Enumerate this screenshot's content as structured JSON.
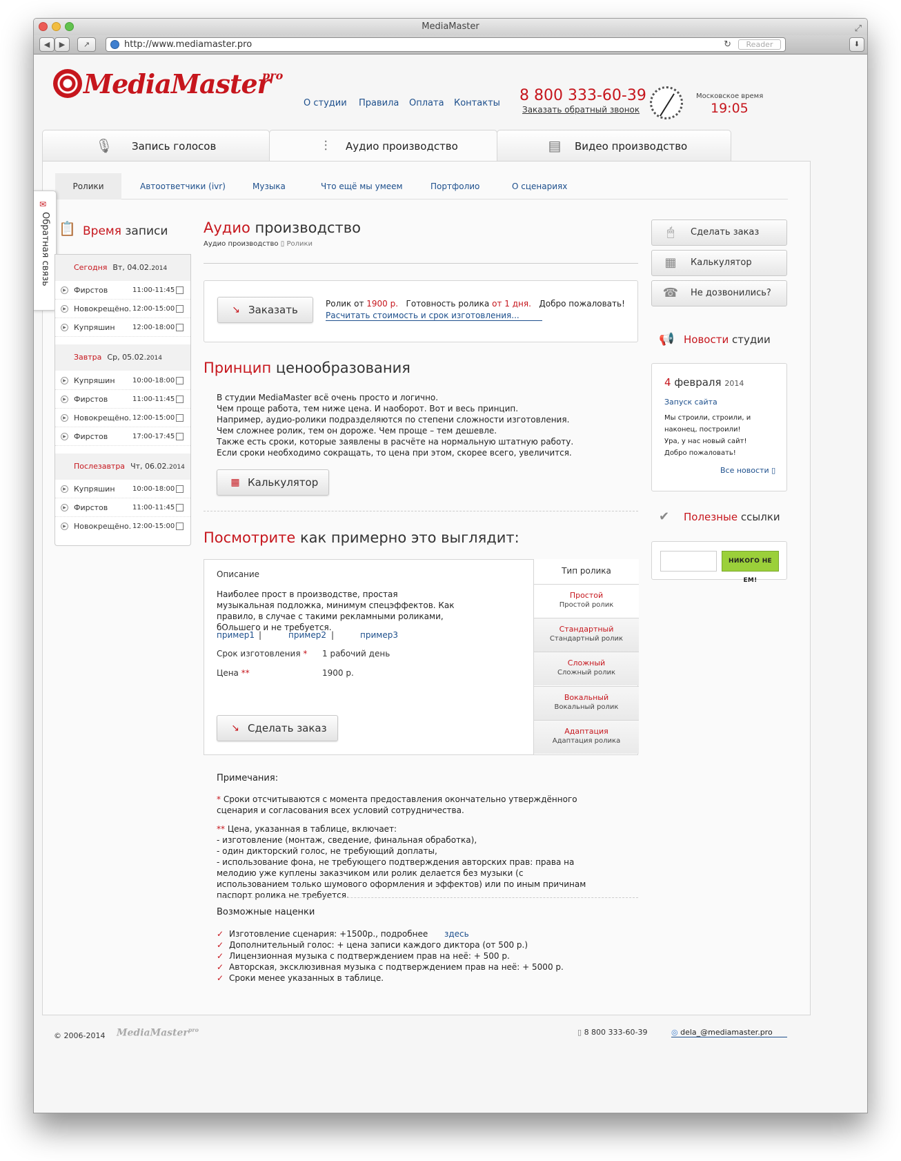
{
  "browser": {
    "title": "MediaMaster",
    "url": "http://www.mediamaster.pro",
    "reader_label": "Reader"
  },
  "header": {
    "logo": "MediaMaster",
    "logo_sup": "pro",
    "nav": [
      "О студии",
      "Правила",
      "Оплата",
      "Контакты"
    ],
    "phone": "8 800 333-60-39",
    "callback": "Заказать обратный звонок",
    "clock_label": "Московское время",
    "clock_time": "19:05"
  },
  "main_tabs": [
    {
      "label": "Запись голосов",
      "icon": "microphone-icon"
    },
    {
      "label": "Аудио производство",
      "icon": "equalizer-icon"
    },
    {
      "label": "Видео производство",
      "icon": "film-icon"
    }
  ],
  "sub_tabs": [
    "Ролики",
    "Автоответчики (ivr)",
    "Музыка",
    "Что ещё мы умеем",
    "Портфолио",
    "О сценариях"
  ],
  "feedback_label": "Обратная связь",
  "schedule": {
    "title_red": "Время",
    "title_rest": "записи",
    "days": [
      {
        "label": "Сегодня",
        "date": "Вт, 04.02.",
        "year": "2014",
        "rows": [
          {
            "name": "Фирстов",
            "time": "11:00-11:45"
          },
          {
            "name": "Новокрещёно.",
            "time": "12:00-15:00"
          },
          {
            "name": "Купряшин",
            "time": "12:00-18:00"
          }
        ]
      },
      {
        "label": "Завтра",
        "date": "Ср, 05.02.",
        "year": "2014",
        "rows": [
          {
            "name": "Купряшин",
            "time": "10:00-18:00"
          },
          {
            "name": "Фирстов",
            "time": "11:00-11:45"
          },
          {
            "name": "Новокрещёно.",
            "time": "12:00-15:00"
          },
          {
            "name": "Фирстов",
            "time": "17:00-17:45"
          }
        ]
      },
      {
        "label": "Послезавтра",
        "date": "Чт, 06.02.",
        "year": "2014",
        "rows": [
          {
            "name": "Купряшин",
            "time": "10:00-18:00"
          },
          {
            "name": "Фирстов",
            "time": "11:00-11:45"
          },
          {
            "name": "Новокрещёно.",
            "time": "12:00-15:00"
          }
        ]
      }
    ]
  },
  "page": {
    "title_red": "Аудио",
    "title_rest": "производство",
    "breadcrumb_link": "Аудио производство",
    "breadcrumb_sep": "▯",
    "breadcrumb_current": "Ролики"
  },
  "order": {
    "button": "Заказать",
    "info_1": "Ролик от",
    "price": "1900 р.",
    "info_2": "Готовность ролика",
    "ready": "от 1 дня.",
    "info_3": "Добро пожаловать!",
    "link": "Расчитать стоимость и срок изготовления..."
  },
  "pricing": {
    "title_red": "Принцип",
    "title_rest": "ценообразования",
    "lines": [
      "В студии MediaMaster всё очень просто и логично.",
      "Чем проще работа, тем ниже цена. И наоборот. Вот и весь принцип.",
      "Например, аудио-ролики подразделяются по степени сложности изготовления. Чем сложнее ролик, тем он дороже. Чем проще – тем дешевле.",
      "Также есть сроки, которые заявлены в расчёте на нормальную штатную работу. Если сроки необходимо сокращать, то цена при этом, скорее всего, увеличится."
    ],
    "calc_button": "Калькулятор"
  },
  "example": {
    "title_red": "Посмотрите",
    "title_rest": "как примерно это выглядит:",
    "desc_header": "Описание",
    "desc": "Наиболее прост в производстве, простая музыкальная подложка, минимум спецэффектов. Как правило, в случае с такими рекламными роликами, бОльшего и не требуется.",
    "examples": [
      "пример1",
      "пример2",
      "пример3"
    ],
    "sep": "|",
    "term_label": "Срок изготовления",
    "term_mark": "*",
    "term_value": "1 рабочий день",
    "price_label": "Цена",
    "price_mark": "**",
    "price_value": "1900 р.",
    "order_button": "Сделать заказ",
    "types_header": "Тип ролика",
    "types": [
      {
        "name": "Простой",
        "sub": "Простой ролик"
      },
      {
        "name": "Стандартный",
        "sub": "Стандартный ролик"
      },
      {
        "name": "Сложный",
        "sub": "Сложный ролик"
      },
      {
        "name": "Вокальный",
        "sub": "Вокальный ролик"
      },
      {
        "name": "Адаптация",
        "sub": "Адаптация ролика"
      }
    ]
  },
  "notes": {
    "header": "Примечания:",
    "n1_mark": "*",
    "n1": "Сроки отсчитываются с момента предоставления окончательно утверждённого сценария и согласования всех условий сотрудничества.",
    "n2_mark": "**",
    "n2_head": "Цена, указанная в таблице, включает:",
    "n2_items": [
      "- изготовление (монтаж, сведение, финальная обработка),",
      "- один дикторский голос, не требующий доплаты,",
      "- использование фона, не требующего подтверждения авторских прав: права на мелодию уже куплены заказчиком или ролик делается без музыки (с использованием только шумового оформления и эффектов) или по иным причинам паспорт ролика не требуется."
    ],
    "extras_header": "Возможные наценки",
    "extras": [
      "Изготовление сценария: +1500р., подробнее",
      "Дополнительный голос: + цена записи каждого диктора (от 500 р.)",
      "Лицензионная музыка с подтверждением прав на неё: + 500 р.",
      "Авторская, эксклюзивная музыка с подтверждением прав на неё: + 5000 р.",
      "Сроки менее указанных в таблице."
    ],
    "extras_link": "здесь"
  },
  "sidebar": {
    "buttons": [
      "Сделать заказ",
      "Калькулятор",
      "Не дозвонились?"
    ],
    "news_title_red": "Новости",
    "news_title_rest": "студии",
    "news_day": "4",
    "news_month": "февраля",
    "news_year": "2014",
    "news_link": "Запуск сайта",
    "news_lines": [
      "Мы строили, строили, и наконец, построили!",
      "Ура, у нас новый сайт!",
      "Добро пожаловать!"
    ],
    "all_news": "Все новости ▯",
    "links_title_red": "Полезные",
    "links_title_rest": "ссылки",
    "badge": "НИКОГО НЕ ЕМ!"
  },
  "footer": {
    "copyright": "© 2006-2014",
    "logo": "MediaMaster",
    "logo_sup": "pro",
    "phone": "8 800 333-60-39",
    "email": "dela_@mediamaster.pro"
  }
}
